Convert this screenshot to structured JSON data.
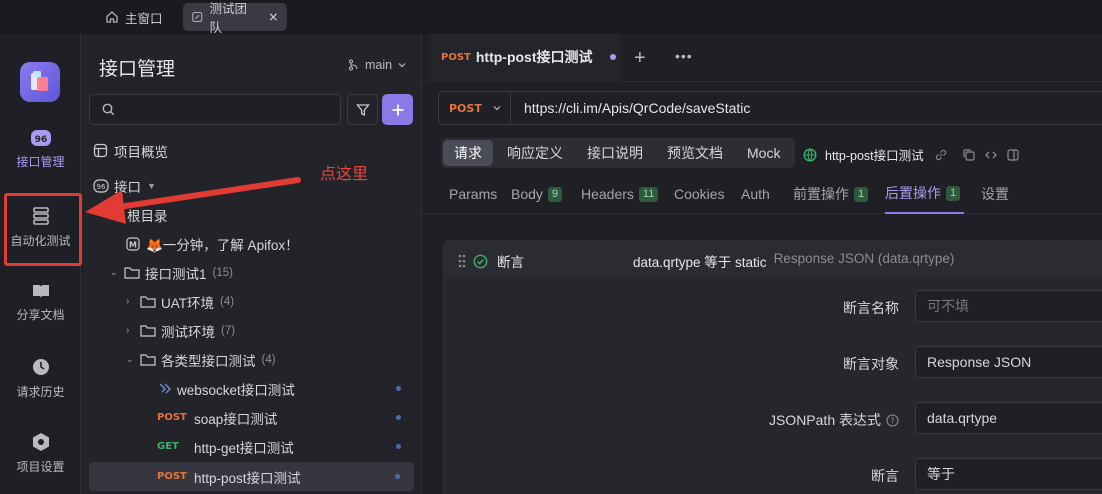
{
  "window_tabs": [
    {
      "label": "主窗口"
    },
    {
      "label": "测试团队"
    }
  ],
  "rail": {
    "items": [
      {
        "label": "接口管理",
        "icon": "api-icon",
        "active": true
      },
      {
        "label": "自动化测试",
        "icon": "automation-icon"
      },
      {
        "label": "分享文档",
        "icon": "book-icon"
      },
      {
        "label": "请求历史",
        "icon": "clock-icon"
      },
      {
        "label": "项目设置",
        "icon": "settings-icon"
      }
    ]
  },
  "tree": {
    "title": "接口管理",
    "branch": "main",
    "search_placeholder": "",
    "overview": "项目概览",
    "interfaces": "接口",
    "root": "根目录",
    "items": [
      {
        "label": "🦊一分钟，了解 Apifox！",
        "kind": "doc"
      },
      {
        "label": "接口测试1",
        "count": "(15)",
        "kind": "folder"
      },
      {
        "label": "UAT环境",
        "count": "(4)",
        "kind": "folder"
      },
      {
        "label": "测试环境",
        "count": "(7)",
        "kind": "folder"
      },
      {
        "label": "各类型接口测试",
        "count": "(4)",
        "kind": "folder"
      },
      {
        "label": "websocket接口测试",
        "kind": "ws"
      },
      {
        "label": "soap接口测试",
        "method": "POST"
      },
      {
        "label": "http-get接口测试",
        "method": "GET"
      },
      {
        "label": "http-post接口测试",
        "method": "POST",
        "selected": true
      }
    ]
  },
  "annotation": {
    "text": "点这里",
    "color": "#e8453c"
  },
  "main": {
    "tab": {
      "method": "POST",
      "label": "http-post接口测试"
    },
    "url_method": "POST",
    "url": "https://cli.im/Apis/QrCode/saveStatic",
    "subtabs": [
      "请求",
      "响应定义",
      "接口说明",
      "预览文档",
      "Mock"
    ],
    "endpoint_name": "http-post接口测试",
    "params_tabs": [
      {
        "label": "Params"
      },
      {
        "label": "Body",
        "badge": "9"
      },
      {
        "label": "Headers",
        "badge": "11"
      },
      {
        "label": "Cookies"
      },
      {
        "label": "Auth"
      },
      {
        "label": "前置操作",
        "badge": "1"
      },
      {
        "label": "后置操作",
        "badge": "1",
        "active": true
      },
      {
        "label": "设置"
      }
    ],
    "assertion": {
      "title": "断言",
      "summary": "data.qrtype 等于 static",
      "summary_hint": "Response JSON (data.qrtype)",
      "fields": [
        {
          "label": "断言名称",
          "value": "",
          "placeholder": "可不填"
        },
        {
          "label": "断言对象",
          "value": "Response JSON"
        },
        {
          "label": "JSONPath 表达式",
          "value": "data.qrtype",
          "help": true
        },
        {
          "label": "断言",
          "value": "等于"
        }
      ]
    }
  }
}
